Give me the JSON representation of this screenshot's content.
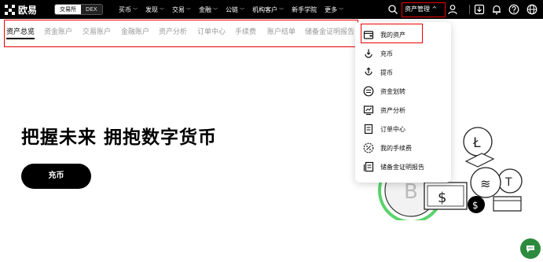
{
  "header": {
    "logo_text": "欧易",
    "segment": {
      "exchange": "交易所",
      "dex": "DEX"
    },
    "nav": [
      {
        "label": "买币",
        "chevron": true
      },
      {
        "label": "发现",
        "chevron": true
      },
      {
        "label": "交易",
        "chevron": true
      },
      {
        "label": "金融",
        "chevron": true
      },
      {
        "label": "公链",
        "chevron": true
      },
      {
        "label": "机构客户",
        "chevron": true
      },
      {
        "label": "新手学院",
        "chevron": false
      },
      {
        "label": "更多",
        "chevron": true
      }
    ],
    "asset_management": "资产管理 ^",
    "icons": [
      "search-icon",
      "user-icon",
      "download-icon",
      "bell-icon",
      "help-icon",
      "globe-icon"
    ]
  },
  "tabs": [
    "资产总览",
    "资金账户",
    "交易账户",
    "金融账户",
    "资产分析",
    "订单中心",
    "手续费",
    "账户结单",
    "储备金证明报告"
  ],
  "active_tab": 0,
  "hero": {
    "title": "把握未来 拥抱数字货币",
    "deposit_button": "充币"
  },
  "dropdown": {
    "items": [
      {
        "label": "我的资产",
        "icon": "wallet-icon"
      },
      {
        "label": "充币",
        "icon": "deposit-icon"
      },
      {
        "label": "提币",
        "icon": "withdraw-icon"
      },
      {
        "label": "资金划转",
        "icon": "transfer-icon"
      },
      {
        "label": "资产分析",
        "icon": "analysis-icon"
      },
      {
        "label": "订单中心",
        "icon": "order-icon"
      },
      {
        "label": "我的手续费",
        "icon": "fee-icon"
      },
      {
        "label": "储备金证明报告",
        "icon": "report-icon"
      }
    ]
  },
  "colors": {
    "accent": "#000000",
    "highlight": "#e00000",
    "chat": "#2b8a3e"
  }
}
